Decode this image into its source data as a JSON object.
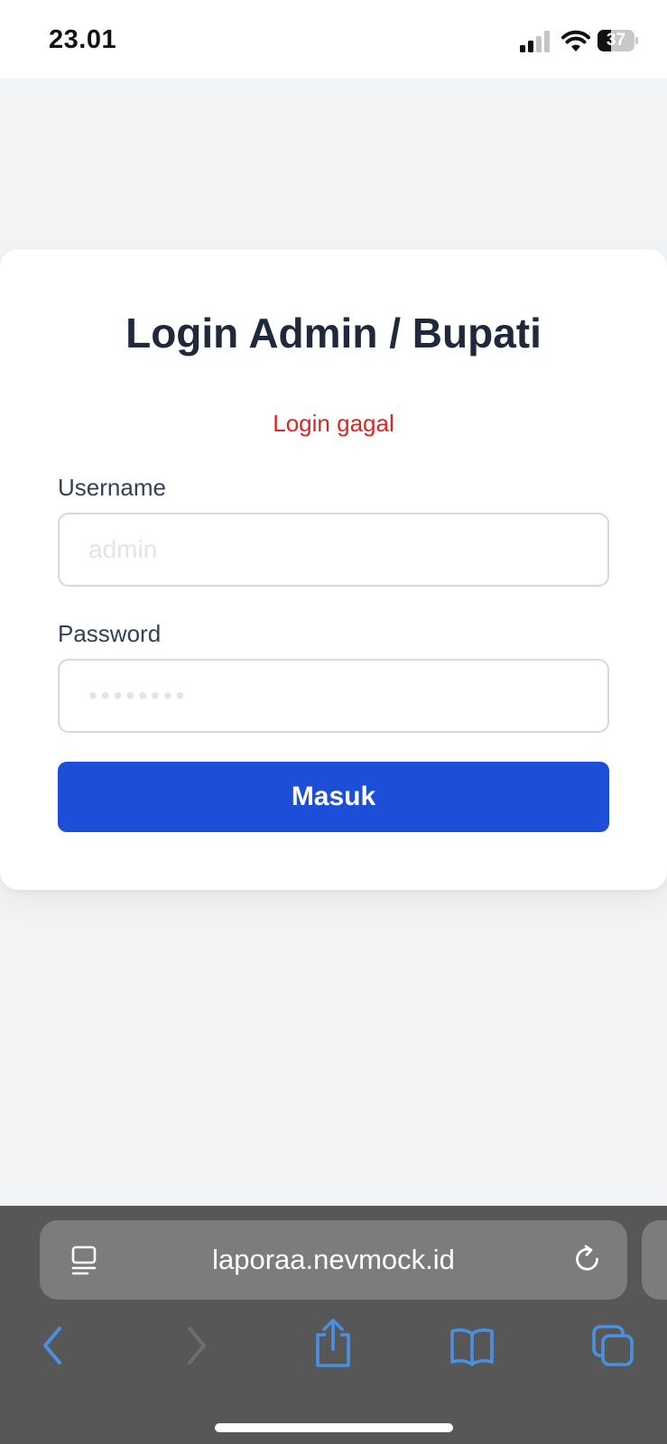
{
  "status_bar": {
    "time": "23.01",
    "battery_level": "37",
    "battery_fraction": 0.37,
    "signal_bars_active": 2,
    "signal_bars_total": 4
  },
  "login": {
    "title": "Login Admin / Bupati",
    "error": "Login gagal",
    "username_label": "Username",
    "username_placeholder": "admin",
    "password_label": "Password",
    "password_placeholder": "••••••••",
    "submit_label": "Masuk"
  },
  "browser": {
    "url": "laporaa.nevmock.id"
  },
  "colors": {
    "primary_button": "#1d4ed8",
    "error_text": "#dc2626",
    "title_text": "#1e293b",
    "page_background": "#f2f3f5",
    "toolbar_background": "#575757",
    "toolbar_icon": "#4a90e2"
  },
  "icons": {
    "status": [
      "signal-icon",
      "wifi-icon",
      "battery-icon"
    ],
    "address_bar": [
      "reader-icon",
      "reload-icon"
    ],
    "toolbar": [
      "back-icon",
      "forward-icon",
      "share-icon",
      "bookmarks-icon",
      "tabs-icon"
    ]
  }
}
